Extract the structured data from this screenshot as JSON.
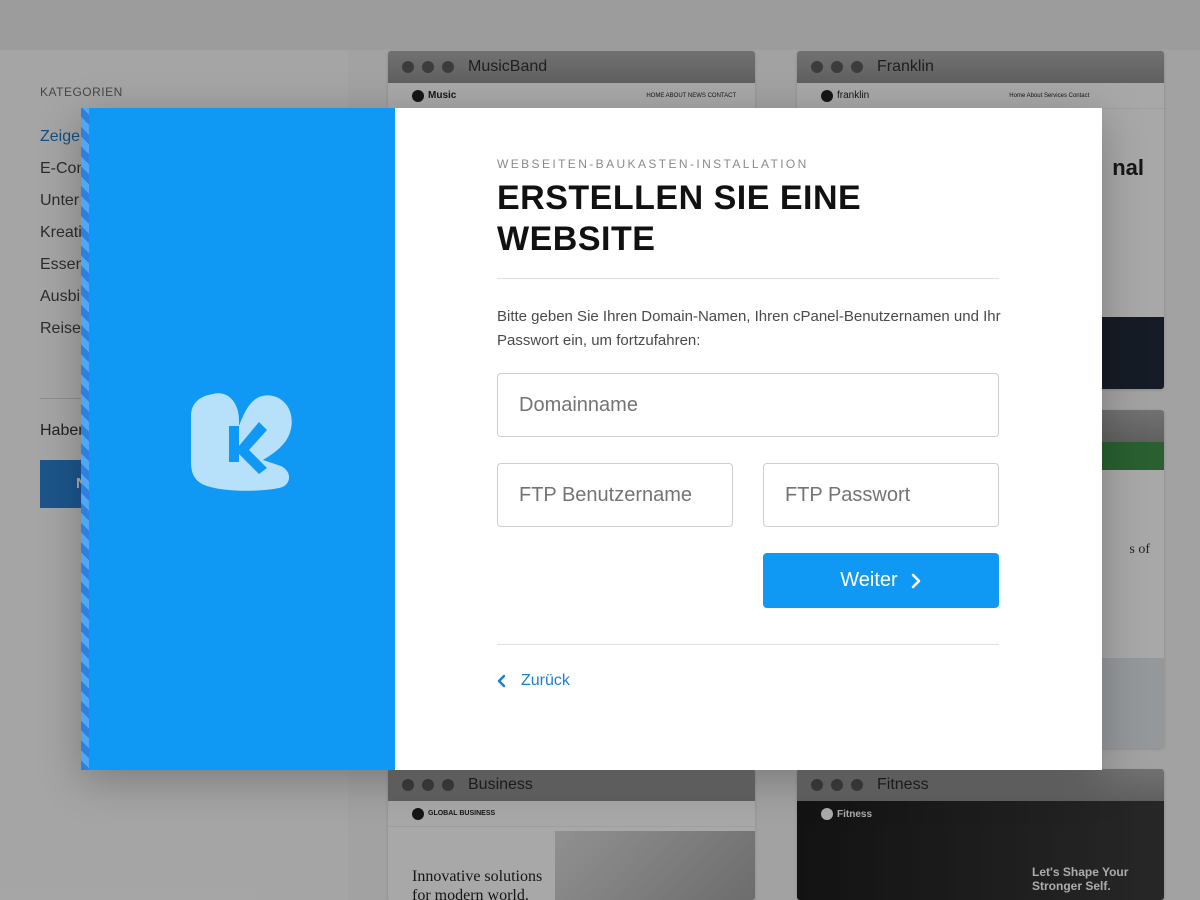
{
  "background": {
    "sidebar": {
      "title": "KATEGORIEN",
      "items": [
        "Zeige",
        "E-Com",
        "Unter",
        "Kreati",
        "Essen",
        "Ausbi",
        "Reiser"
      ],
      "have_text": "Haben",
      "button_label": "N"
    },
    "cards": [
      {
        "title": "MusicBand",
        "logo": "Music",
        "nav": "HOME  ABOUT  NEWS  CONTACT"
      },
      {
        "title": "Franklin",
        "logo": "franklin",
        "nav": "Home  About  Services  Contact",
        "fragment": "nal"
      },
      {
        "title": "",
        "fragment": "s of"
      },
      {
        "title": "Business",
        "logo": "GLOBAL BUSINESS",
        "headline": "Innovative solutions for modern world."
      },
      {
        "title": "Fitness",
        "logo": "Fitness",
        "headline": "Let's Shape Your Stronger Self."
      }
    ]
  },
  "modal": {
    "eyebrow": "WEBSEITEN-BAUKASTEN-INSTALLATION",
    "heading": "ERSTELLEN SIE EINE WEBSITE",
    "description": "Bitte geben Sie Ihren Domain-Namen, Ihren cPanel-Benutzernamen und Ihr Passwort ein, um fortzufahren:",
    "fields": {
      "domain": {
        "placeholder": "Domainname",
        "value": ""
      },
      "ftp_user": {
        "placeholder": "FTP Benutzername",
        "value": ""
      },
      "ftp_password": {
        "placeholder": "FTP Passwort",
        "value": ""
      }
    },
    "next_label": "Weiter",
    "back_label": "Zurück",
    "icons": {
      "logo": "brand-k-logo-icon",
      "next": "chevron-right-icon",
      "back": "chevron-left-icon"
    },
    "colors": {
      "accent": "#0f99f5",
      "link": "#1b7fd1"
    }
  }
}
